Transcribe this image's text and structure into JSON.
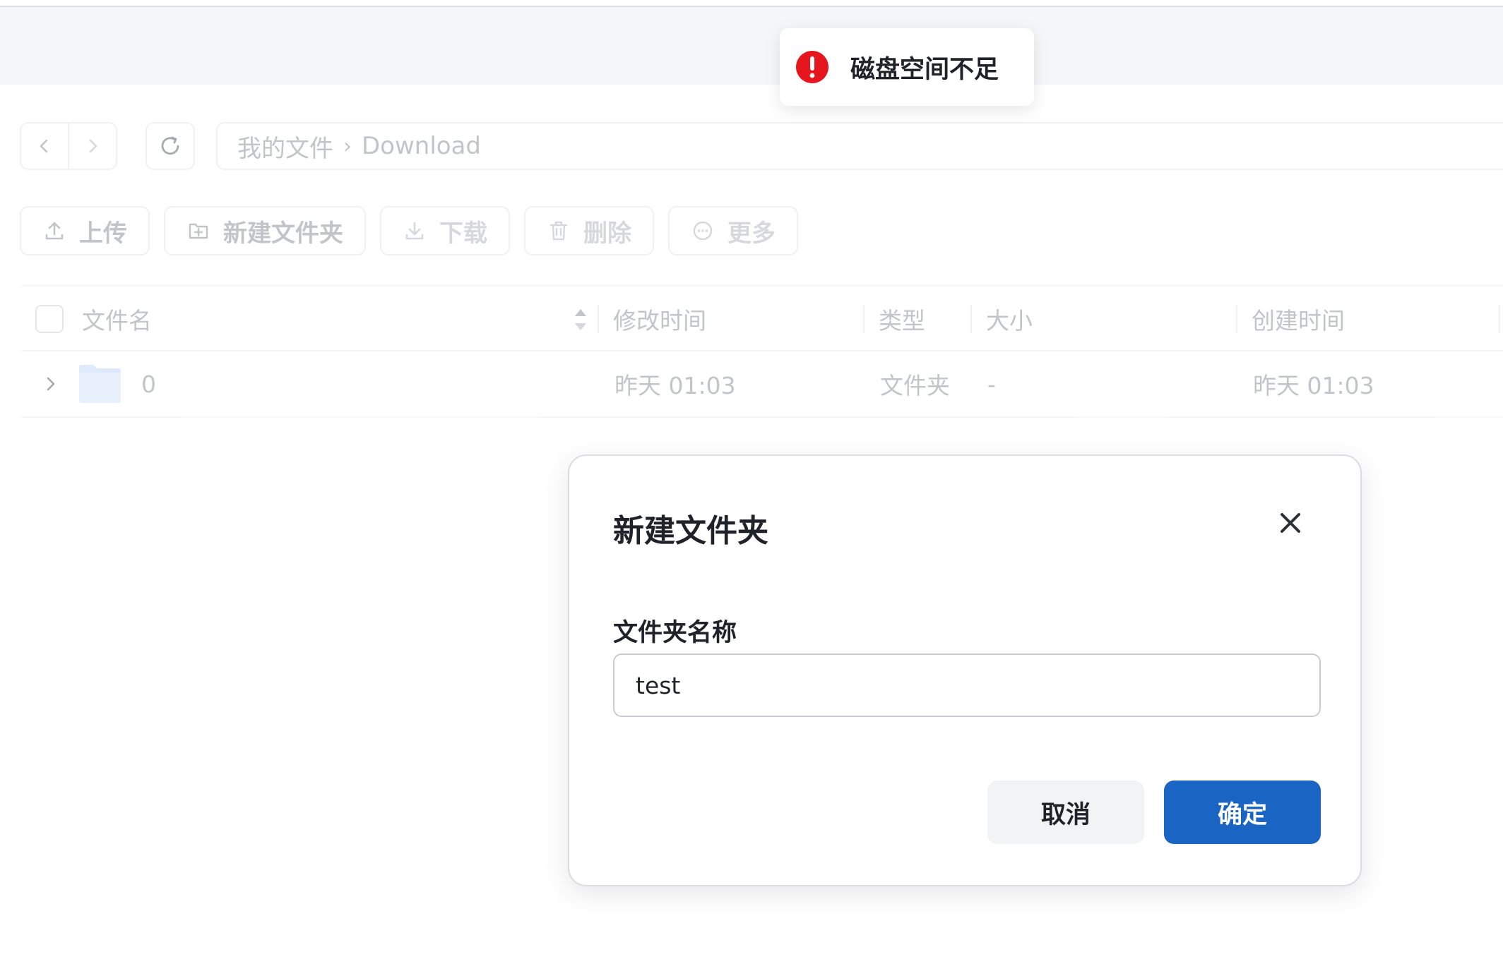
{
  "toast": {
    "icon": "error-icon",
    "message": "磁盘空间不足",
    "color": "#e5161d"
  },
  "breadcrumb": {
    "root": "我的文件",
    "separator": "›",
    "current": "Download"
  },
  "toolbar": {
    "upload_label": "上传",
    "new_folder_label": "新建文件夹",
    "download_label": "下载",
    "delete_label": "删除",
    "more_label": "更多"
  },
  "table": {
    "columns": {
      "name": "文件名",
      "modified": "修改时间",
      "type": "类型",
      "size": "大小",
      "created": "创建时间"
    },
    "rows": [
      {
        "name": "0",
        "modified": "昨天 01:03",
        "type": "文件夹",
        "size": "-",
        "created": "昨天 01:03"
      }
    ]
  },
  "dialog": {
    "title": "新建文件夹",
    "field_label": "文件夹名称",
    "field_value": "test",
    "cancel_label": "取消",
    "ok_label": "确定",
    "accent_color": "#1a64c4"
  }
}
